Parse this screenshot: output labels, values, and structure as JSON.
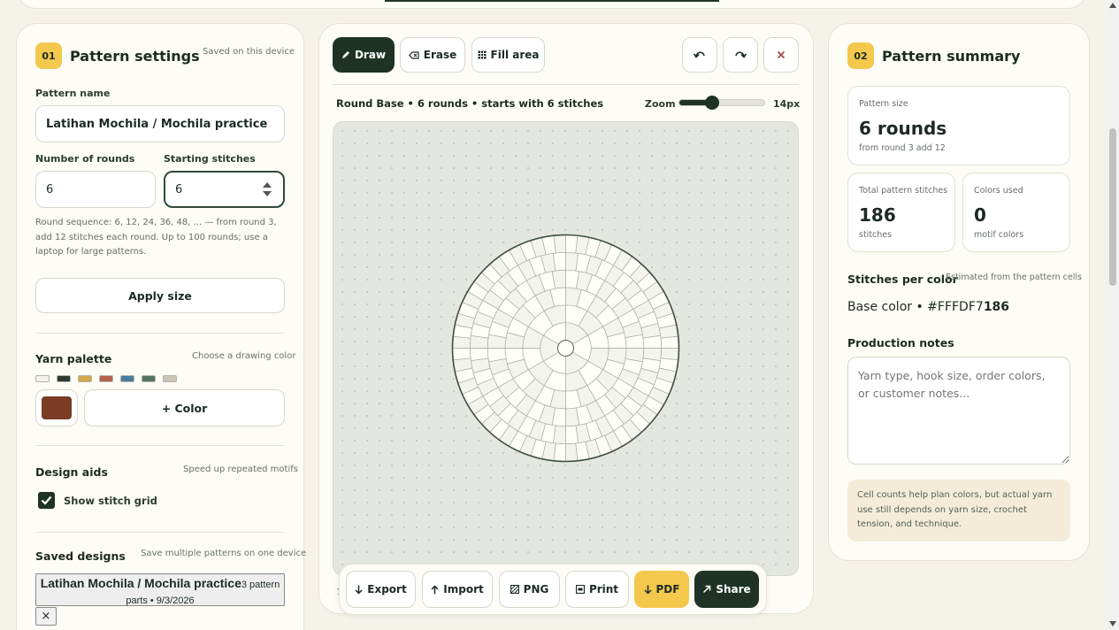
{
  "colors": {
    "accent": "#f3c84c",
    "dark_green": "#1e3326",
    "selected_color": "#7a3c24"
  },
  "left_panel": {
    "badge": "01",
    "title": "Pattern settings",
    "saved_hint": "Saved on this device",
    "pattern_name_label": "Pattern name",
    "pattern_name_value": "Latihan Mochila / Mochila practice",
    "rounds_label": "Number of rounds",
    "rounds_value": "6",
    "starting_label": "Starting stitches",
    "starting_value": "6",
    "sequence_desc": "Round sequence: 6, 12, 24, 36, 48, ... — from round 3, add 12 stitches each round. Up to 100 rounds; use a laptop for large patterns.",
    "apply_button": "Apply size",
    "palette_title": "Yarn palette",
    "palette_hint": "Choose a drawing color",
    "palette_swatches": [
      "#f5f3ea",
      "#2c3b33",
      "#d4a94a",
      "#b2614e",
      "#4b7a9c",
      "#557564",
      "#c9c5b8"
    ],
    "add_color_label": "+ Color",
    "design_aids_title": "Design aids",
    "design_aids_hint": "Speed up repeated motifs",
    "show_grid_label": "Show stitch grid",
    "show_grid_checked": true,
    "saved_designs_title": "Saved designs",
    "saved_designs_hint": "Save multiple patterns on one device",
    "saved_design_name": "Latihan Mochila / Mochila practice",
    "saved_design_meta": "3 pattern parts • 9/3/2026",
    "delete_label": "×"
  },
  "toolbar": {
    "draw_label": "Draw",
    "erase_label": "Erase",
    "fill_label": "Fill area",
    "undo_icon": "undo-icon",
    "redo_icon": "redo-icon",
    "clear_icon": "close-icon"
  },
  "canvas_info": {
    "description": "Round Base • 6 rounds • starts with 6 stitches",
    "zoom_label": "Zoom",
    "zoom_value": "14px",
    "zoom_fraction": 0.38
  },
  "chart_data": {
    "rounds": 6,
    "stitches_per_round": [
      6,
      12,
      24,
      36,
      48,
      60
    ]
  },
  "bottom_actions": {
    "export_label": "Export",
    "import_label": "Import",
    "png_label": "PNG",
    "print_label": "Print",
    "pdf_label": "PDF",
    "share_label": "Share"
  },
  "right_panel": {
    "badge": "02",
    "title": "Pattern summary",
    "size_label": "Pattern size",
    "size_value": "6 rounds",
    "size_sub": "from round 3 add 12",
    "total_label": "Total pattern stitches",
    "total_value": "186",
    "total_sub": "stitches",
    "colors_label": "Colors used",
    "colors_value": "0",
    "colors_sub": "motif colors",
    "per_color_title": "Stitches per color",
    "per_color_hint": "Estimated from the pattern cells",
    "per_color_name": "Base color • #FFFDF7",
    "per_color_count": "186",
    "notes_title": "Production notes",
    "notes_placeholder": "Yarn type, hook size, order colors, or customer notes...",
    "info_note": "Cell counts help plan colors, but actual yarn use still depends on yarn size, crochet tension, and technique."
  }
}
